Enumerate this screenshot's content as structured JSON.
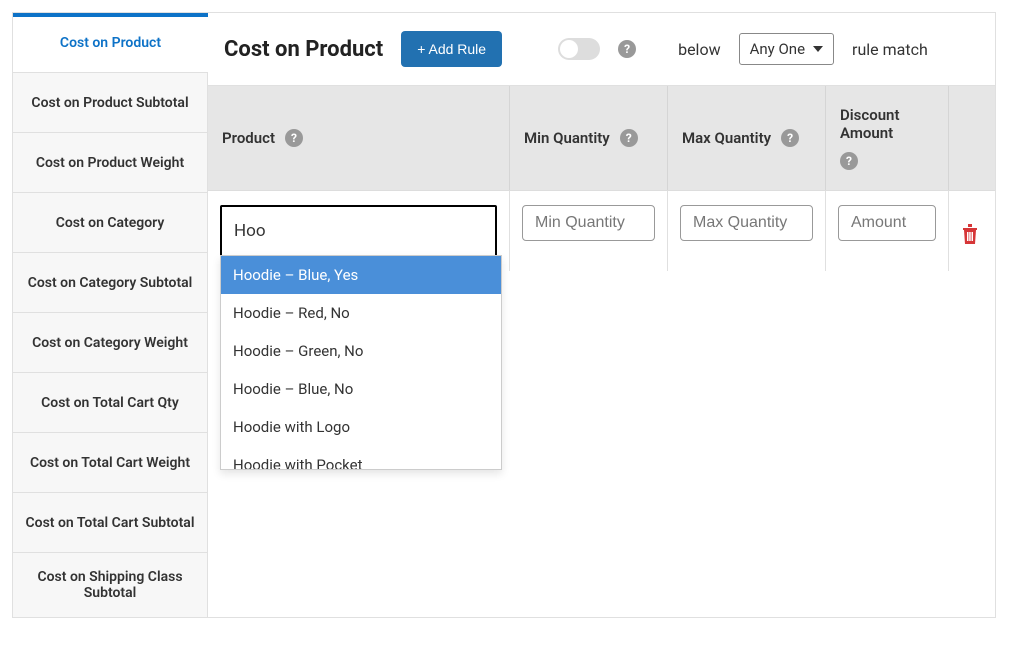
{
  "sidebar": {
    "items": [
      "Cost on Product",
      "Cost on Product Subtotal",
      "Cost on Product Weight",
      "Cost on Category",
      "Cost on Category Subtotal",
      "Cost on Category Weight",
      "Cost on Total Cart Qty",
      "Cost on Total Cart Weight",
      "Cost on Total Cart Subtotal",
      "Cost on Shipping Class Subtotal"
    ],
    "active_index": 0
  },
  "header": {
    "title": "Cost on Product",
    "add_rule": "+ Add Rule",
    "below": "below",
    "select_value": "Any One",
    "rule_match": "rule match"
  },
  "columns": {
    "product": "Product",
    "min_qty": "Min Quantity",
    "max_qty": "Max Quantity",
    "discount": "Discount Amount"
  },
  "row": {
    "search_value": "Hoo",
    "min_placeholder": "Min Quantity",
    "max_placeholder": "Max Quantity",
    "amount_placeholder": "Amount"
  },
  "dropdown": {
    "options": [
      "Hoodie – Blue, Yes",
      "Hoodie – Red, No",
      "Hoodie – Green, No",
      "Hoodie – Blue, No",
      "Hoodie with Logo",
      "Hoodie with Pocket"
    ],
    "highlight_index": 0
  },
  "icons": {
    "help_glyph": "?"
  }
}
